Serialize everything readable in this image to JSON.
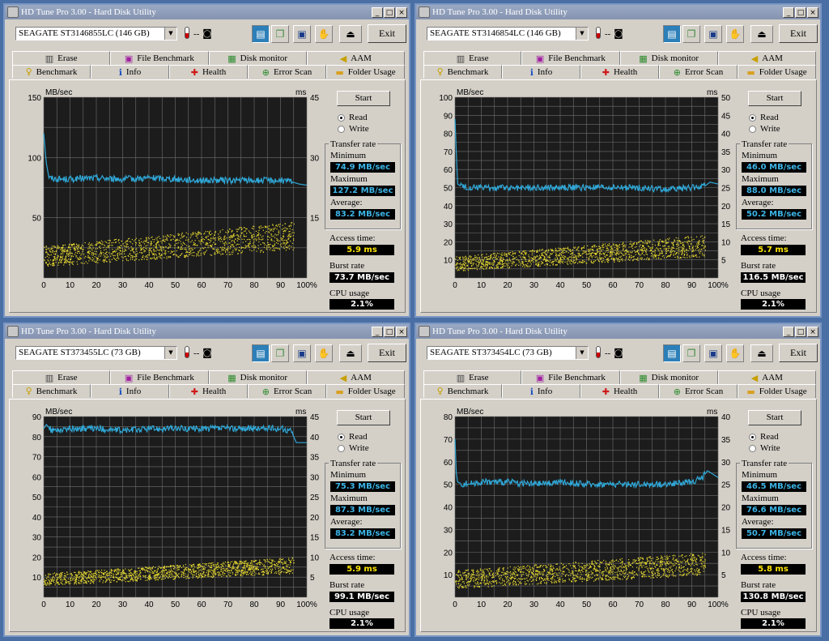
{
  "app": {
    "title": "HD Tune Pro 3.00 - Hard Disk Utility",
    "temp": "--",
    "exit_label": "Exit",
    "tabs_row1": [
      "Erase",
      "File Benchmark",
      "Disk monitor",
      "AAM"
    ],
    "tabs_row2": [
      "Benchmark",
      "Info",
      "Health",
      "Error Scan",
      "Folder Usage"
    ],
    "selected_tab": "Benchmark",
    "start_label": "Start",
    "read_label": "Read",
    "write_label": "Write",
    "transfer_rate_label": "Transfer rate",
    "minimum_label": "Minimum",
    "maximum_label": "Maximum",
    "average_label": "Average:",
    "access_time_label": "Access time:",
    "burst_rate_label": "Burst rate",
    "cpu_usage_label": "CPU usage",
    "mbsec_unit": "MB/sec",
    "ms_unit": "ms",
    "colors": {
      "transfer_line": "#2fa8d8",
      "access_dots": "#e6d830",
      "chart_bg": "#1c1c1c",
      "grid": "#707070"
    }
  },
  "windows": [
    {
      "drive": "SEAGATE ST3146855LC (146 GB)",
      "minimum": "74.9 MB/sec",
      "maximum": "127.2 MB/sec",
      "average": "83.2 MB/sec",
      "access_time": "5.9 ms",
      "burst_rate": "73.7 MB/sec",
      "cpu_usage": "2.1%"
    },
    {
      "drive": "SEAGATE ST3146854LC (146 GB)",
      "minimum": "46.0 MB/sec",
      "maximum": "88.0 MB/sec",
      "average": "50.2 MB/sec",
      "access_time": "5.7 ms",
      "burst_rate": "116.5 MB/sec",
      "cpu_usage": "2.1%"
    },
    {
      "drive": "SEAGATE ST373455LC (73 GB)",
      "minimum": "75.3 MB/sec",
      "maximum": "87.3 MB/sec",
      "average": "83.2 MB/sec",
      "access_time": "5.9 ms",
      "burst_rate": "99.1 MB/sec",
      "cpu_usage": "2.1%"
    },
    {
      "drive": "SEAGATE ST373454LC (73 GB)",
      "minimum": "46.5 MB/sec",
      "maximum": "76.6 MB/sec",
      "average": "50.7 MB/sec",
      "access_time": "5.8 ms",
      "burst_rate": "130.8 MB/sec",
      "cpu_usage": "2.1%"
    }
  ],
  "chart_data": [
    {
      "type": "line",
      "xlabel": "",
      "ylabel": "MB/sec",
      "y2label": "ms",
      "x_ticks": [
        "0",
        "10",
        "20",
        "30",
        "40",
        "50",
        "60",
        "70",
        "80",
        "90",
        "100%"
      ],
      "xlim": [
        0,
        100
      ],
      "ylim": [
        0,
        150
      ],
      "y2lim": [
        0,
        45
      ],
      "y_ticks": [
        "150",
        "100",
        "50"
      ],
      "y2_ticks": [
        "45",
        "30",
        "15"
      ],
      "grid": true,
      "series": [
        {
          "axis": "left",
          "x": [
            0,
            1,
            2,
            5,
            10,
            20,
            30,
            40,
            50,
            60,
            70,
            80,
            90,
            94,
            97,
            100
          ],
          "values": [
            120,
            95,
            83,
            82,
            82,
            83,
            82,
            83,
            82,
            81,
            81,
            81,
            81,
            80,
            78,
            77
          ]
        },
        {
          "axis": "right",
          "style": "dots",
          "range_start": [
            0,
            3,
            8
          ],
          "range_end": [
            95,
            7,
            14
          ],
          "count": 1400
        }
      ]
    },
    {
      "type": "line",
      "xlabel": "",
      "ylabel": "MB/sec",
      "y2label": "ms",
      "x_ticks": [
        "0",
        "10",
        "20",
        "30",
        "40",
        "50",
        "60",
        "70",
        "80",
        "90",
        "100%"
      ],
      "xlim": [
        0,
        100
      ],
      "ylim": [
        0,
        100
      ],
      "y2lim": [
        0,
        50
      ],
      "y_ticks": [
        "100",
        "90",
        "80",
        "70",
        "60",
        "50",
        "40",
        "30",
        "20",
        "10"
      ],
      "y2_ticks": [
        "50",
        "45",
        "40",
        "35",
        "30",
        "25",
        "20",
        "15",
        "10",
        "5"
      ],
      "grid": true,
      "series": [
        {
          "axis": "left",
          "x": [
            0,
            0.5,
            1,
            3,
            10,
            20,
            30,
            40,
            50,
            60,
            70,
            80,
            90,
            95,
            97,
            100
          ],
          "values": [
            88,
            70,
            52,
            50,
            50,
            50,
            50,
            50,
            50,
            50,
            50,
            49,
            50,
            51,
            53,
            52
          ]
        },
        {
          "axis": "right",
          "style": "dots",
          "range_start": [
            0,
            2,
            6
          ],
          "range_end": [
            95,
            6,
            12
          ],
          "count": 1400
        }
      ]
    },
    {
      "type": "line",
      "xlabel": "",
      "ylabel": "MB/sec",
      "y2label": "ms",
      "x_ticks": [
        "0",
        "10",
        "20",
        "30",
        "40",
        "50",
        "60",
        "70",
        "80",
        "90",
        "100%"
      ],
      "xlim": [
        0,
        100
      ],
      "ylim": [
        0,
        90
      ],
      "y2lim": [
        0,
        45
      ],
      "y_ticks": [
        "90",
        "80",
        "70",
        "60",
        "50",
        "40",
        "30",
        "20",
        "10"
      ],
      "y2_ticks": [
        "45",
        "40",
        "35",
        "30",
        "25",
        "20",
        "15",
        "10",
        "5"
      ],
      "grid": true,
      "series": [
        {
          "axis": "left",
          "x": [
            0,
            1,
            3,
            10,
            20,
            30,
            40,
            50,
            60,
            70,
            80,
            90,
            94,
            96,
            100
          ],
          "values": [
            84,
            86,
            83,
            84,
            84,
            83,
            84,
            84,
            84,
            84,
            84,
            84,
            83,
            77,
            77
          ]
        },
        {
          "axis": "right",
          "style": "dots",
          "range_start": [
            0,
            3,
            6
          ],
          "range_end": [
            95,
            6,
            10
          ],
          "count": 1400
        }
      ]
    },
    {
      "type": "line",
      "xlabel": "",
      "ylabel": "MB/sec",
      "y2label": "ms",
      "x_ticks": [
        "0",
        "10",
        "20",
        "30",
        "40",
        "50",
        "60",
        "70",
        "80",
        "90",
        "100%"
      ],
      "xlim": [
        0,
        100
      ],
      "ylim": [
        0,
        80
      ],
      "y2lim": [
        0,
        40
      ],
      "y_ticks": [
        "80",
        "70",
        "60",
        "50",
        "40",
        "30",
        "20",
        "10"
      ],
      "y2_ticks": [
        "40",
        "35",
        "30",
        "25",
        "20",
        "15",
        "10",
        "5"
      ],
      "grid": true,
      "series": [
        {
          "axis": "left",
          "x": [
            0,
            0.5,
            1,
            3,
            10,
            20,
            30,
            40,
            50,
            60,
            70,
            80,
            90,
            94,
            96,
            100
          ],
          "values": [
            70,
            55,
            51,
            50,
            51,
            51,
            50,
            51,
            50,
            50,
            50,
            50,
            51,
            53,
            56,
            53
          ]
        },
        {
          "axis": "right",
          "style": "dots",
          "range_start": [
            0,
            2,
            6
          ],
          "range_end": [
            95,
            5,
            10
          ],
          "count": 1400
        }
      ]
    }
  ]
}
